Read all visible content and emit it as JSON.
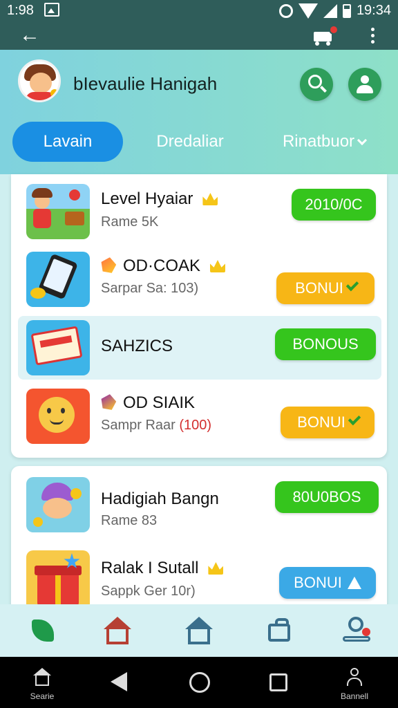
{
  "status_bar": {
    "time_left": "1:98",
    "time_right": "19:34"
  },
  "header": {
    "user_name": "bIevaulie Hanigah",
    "tabs": [
      {
        "label": "Lavain",
        "active": true
      },
      {
        "label": "Dredaliar",
        "active": false
      },
      {
        "label": "Rinatbuor",
        "active": false
      }
    ]
  },
  "list1": [
    {
      "title": "Level Hyaiar",
      "subtitle": "Rame 5K",
      "subtitle_highlight": "",
      "button": "2010/0C",
      "button_color": "green",
      "title_prefix_icon": "",
      "title_suffix_icon": "crown-icon"
    },
    {
      "title": "OD·COAK",
      "subtitle": "Sarpar Sa: 103)",
      "subtitle_highlight": "",
      "button": "BONUI",
      "button_color": "yellow",
      "title_prefix_icon": "gem-icon",
      "title_suffix_icon": "crown-icon"
    },
    {
      "title": "SAHZICS",
      "subtitle": "",
      "subtitle_highlight": "",
      "button": "BONOUS",
      "button_color": "green",
      "title_prefix_icon": "",
      "title_suffix_icon": ""
    },
    {
      "title": "OD SIAIK",
      "subtitle": "Sampr Raar ",
      "subtitle_highlight": "(100)",
      "button": "BONUI",
      "button_color": "yellow",
      "title_prefix_icon": "gem-icon",
      "title_suffix_icon": ""
    }
  ],
  "list2": [
    {
      "title": "Hadigiah Bangn",
      "subtitle": "Rame 83",
      "button": "80U0BOS",
      "button_color": "green",
      "title_suffix_icon": ""
    },
    {
      "title": "Ralak I Sutall",
      "subtitle": "Sappk Ger 10r)",
      "button": "BONUI",
      "button_color": "blue",
      "title_suffix_icon": "crown-icon"
    }
  ],
  "system_nav": {
    "left_label": "Searie",
    "right_label": "Bannell"
  },
  "colors": {
    "accent": "#1a8fe3",
    "button_green": "#35c51d",
    "button_yellow": "#f7b616",
    "button_blue": "#3ba9e6",
    "toolbar": "#2f5d5a"
  }
}
